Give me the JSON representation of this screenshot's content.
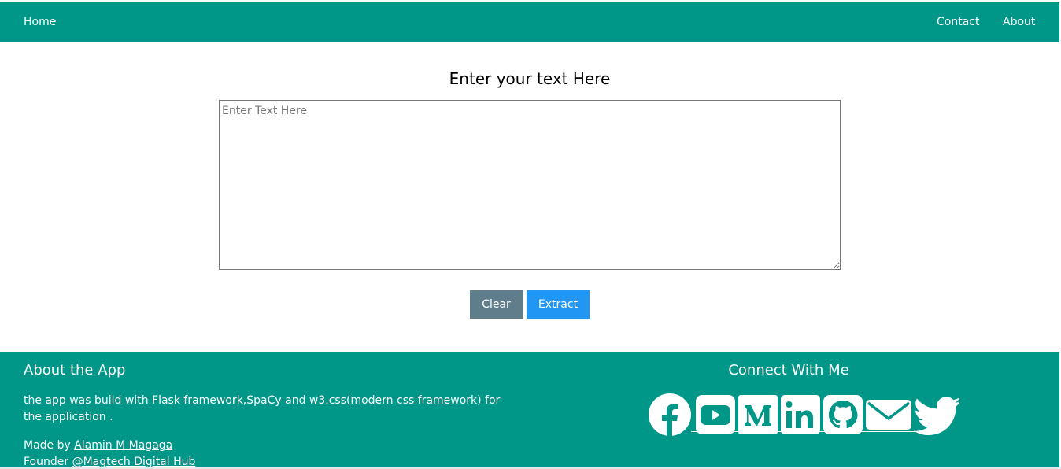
{
  "navbar": {
    "home_label": "Home",
    "contact_label": "Contact",
    "about_label": "About"
  },
  "main": {
    "title": "Enter your text Here",
    "textarea": {
      "placeholder": "Enter Text Here",
      "value": ""
    },
    "clear_label": "Clear",
    "extract_label": "Extract"
  },
  "footer": {
    "about_title": "About the App",
    "about_text": "the app was build with Flask framework,SpaCy and w3.css(modern css framework) for the application .",
    "made_by_prefix": "Made by ",
    "author_name": "Alamin M Magaga",
    "founder_prefix": "Founder ",
    "company_name": "@Magtech Digital Hub",
    "connect_title": "Connect With Me",
    "social_icons": [
      "facebook-icon",
      "youtube-icon",
      "medium-icon",
      "linkedin-icon",
      "github-icon",
      "email-icon",
      "twitter-icon"
    ]
  },
  "colors": {
    "teal": "#009688",
    "clear_button": "#607d8b",
    "extract_button": "#2196f3"
  }
}
